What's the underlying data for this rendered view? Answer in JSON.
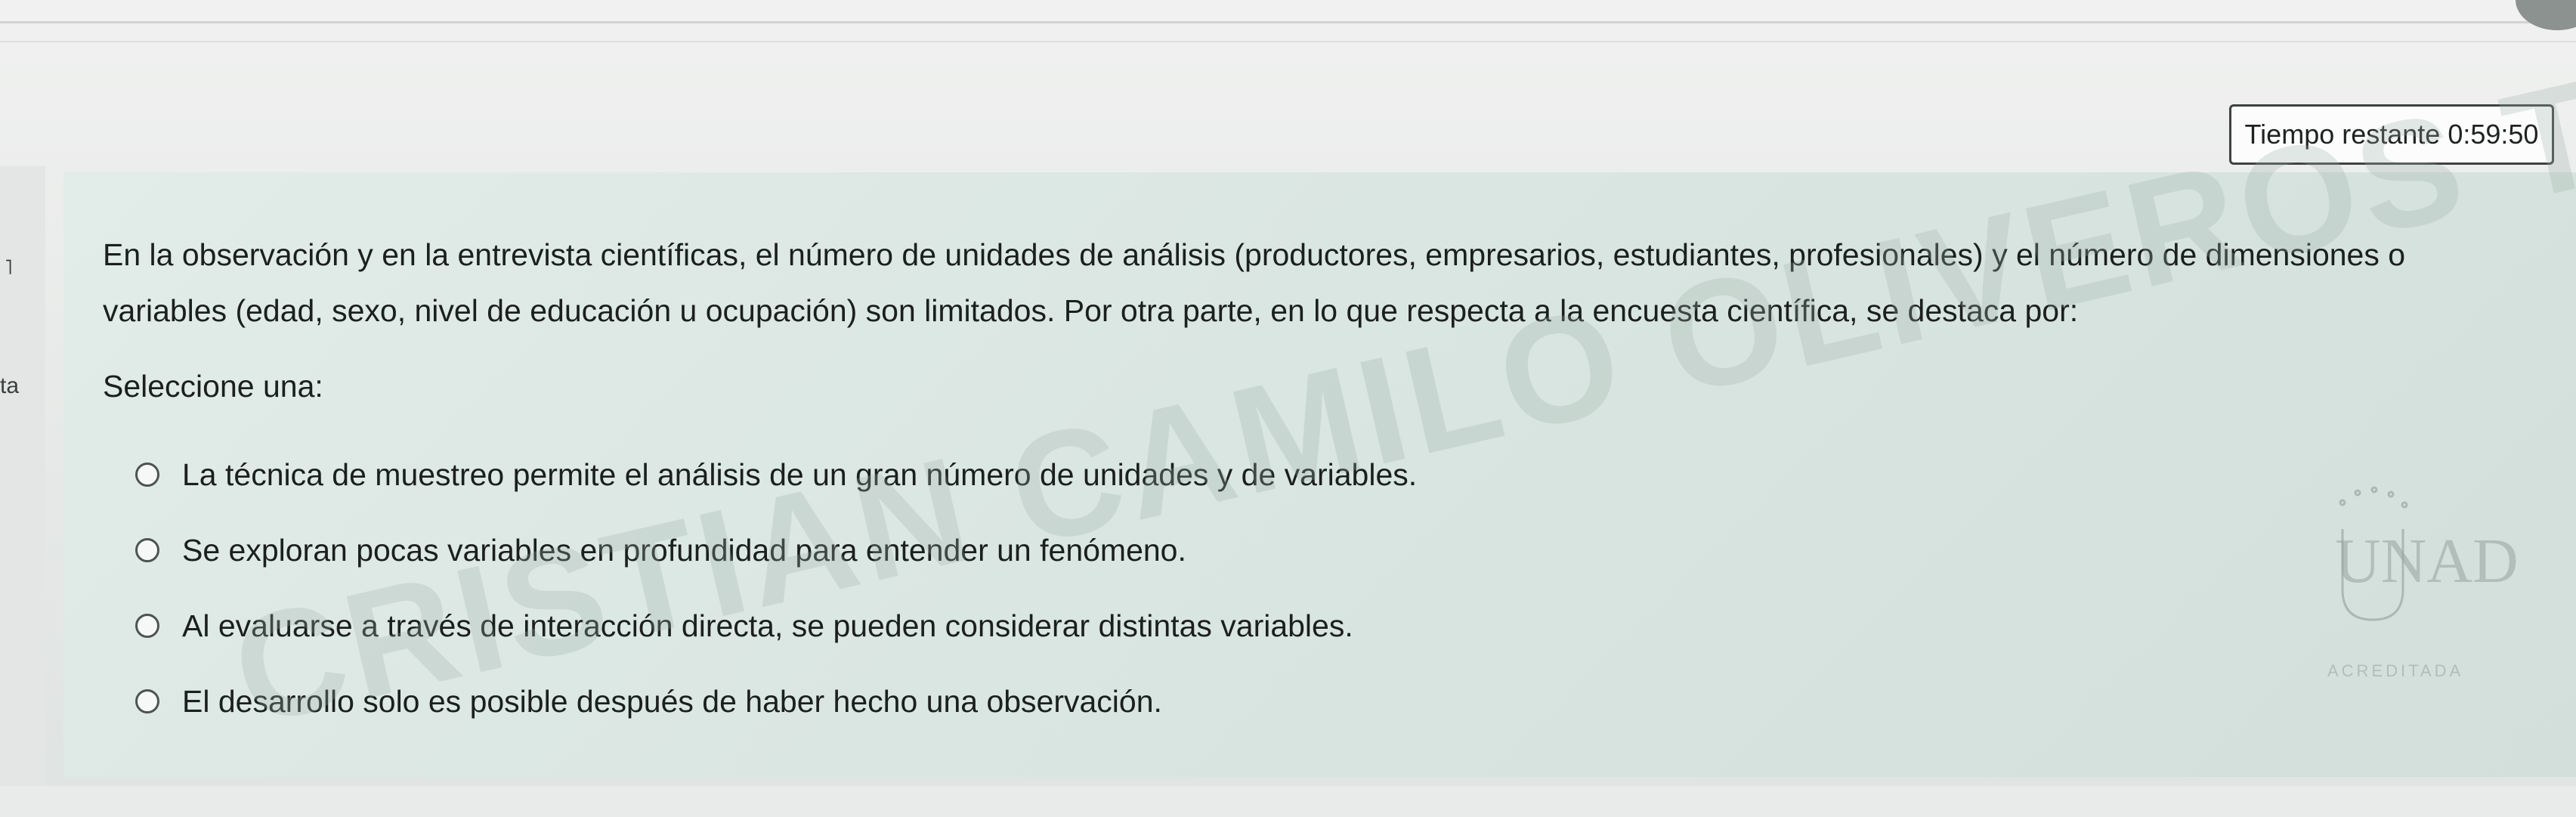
{
  "timer": {
    "label": "Tiempo restante",
    "value": "0:59:50"
  },
  "left_edge": {
    "tag": "ta"
  },
  "question": {
    "text": "En la observación y en la entrevista científicas, el número de unidades de análisis (productores, empresarios, estudiantes, profesionales) y el número de dimensiones o variables (edad, sexo, nivel de educación u ocupación) son limitados. Por otra parte, en lo que respecta a la encuesta científica, se destaca por:",
    "prompt": "Seleccione una:",
    "options": [
      {
        "label": "La técnica de muestreo permite el análisis de un gran número de unidades y de variables."
      },
      {
        "label": "Se exploran pocas variables en profundidad para entender un fenómeno."
      },
      {
        "label": "Al evaluarse a través de interacción directa, se pueden considerar distintas variables."
      },
      {
        "label": "El desarrollo solo es posible después de haber hecho una observación."
      }
    ]
  },
  "watermark": {
    "text": "CRISTIAN CAMILO OLIVEROS TAFUR"
  },
  "logo": {
    "text": "UNAD",
    "caption": "ACREDITADA",
    "icon": "unad-logo-icon"
  }
}
